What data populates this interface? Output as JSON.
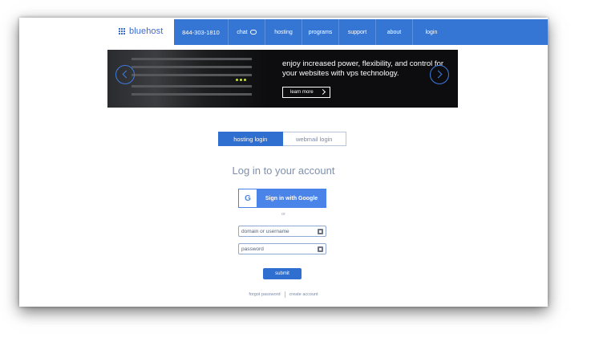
{
  "nav": {
    "logo_text": "bluehost",
    "phone": "844-303-1810",
    "items": [
      {
        "label": "chat"
      },
      {
        "label": "hosting"
      },
      {
        "label": "programs"
      },
      {
        "label": "support"
      },
      {
        "label": "about"
      },
      {
        "label": "login"
      }
    ]
  },
  "banner": {
    "line1": "enjoy increased power, flexibility, and control for",
    "line2": "your websites with vps technology.",
    "cta": "learn more"
  },
  "tabs": [
    {
      "label": "hosting login",
      "active": true
    },
    {
      "label": "webmail login",
      "active": false
    }
  ],
  "login": {
    "title": "Log in to your account",
    "google_label": "Sign in with Google",
    "google_glyph": "G",
    "or_text": "or",
    "username_placeholder": "domain or username",
    "password_placeholder": "password",
    "submit_label": "submit"
  },
  "footer": {
    "forgot": "forgot password",
    "create": "create account"
  },
  "colors": {
    "brand_blue": "#3575d3",
    "button_blue": "#2f6fcf",
    "google_blue": "#4a84e8"
  }
}
